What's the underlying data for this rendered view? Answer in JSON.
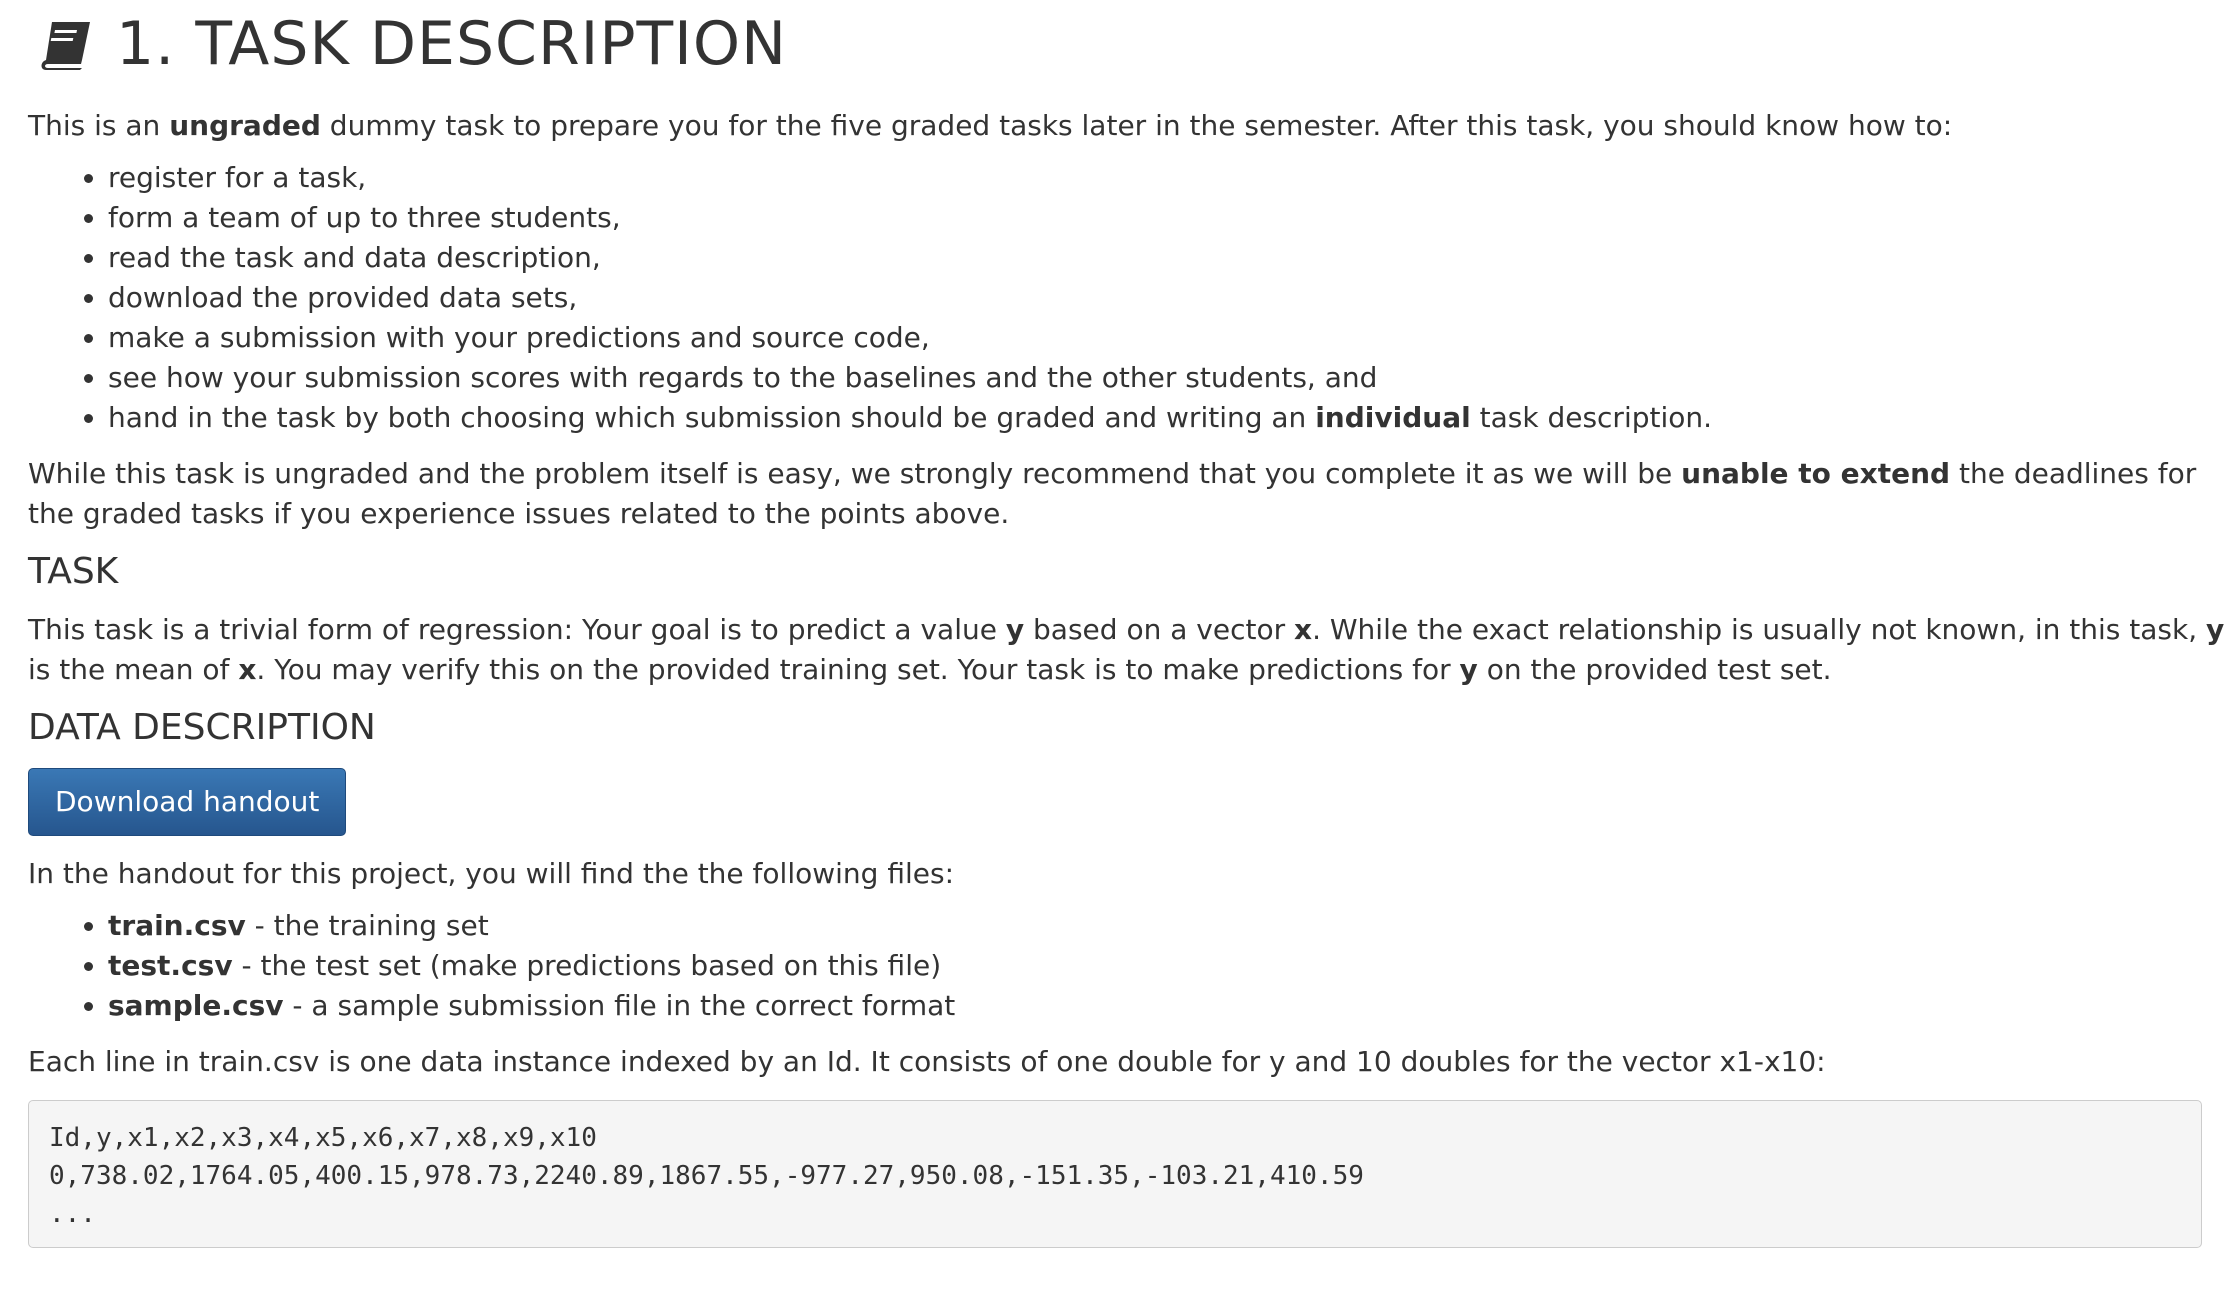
{
  "header": {
    "icon": "book-icon",
    "title": "1. TASK DESCRIPTION"
  },
  "intro": {
    "pre": "This is an ",
    "bold": "ungraded",
    "post": " dummy task to prepare you for the five graded tasks later in the semester. After this task, you should know how to:"
  },
  "learn_items": [
    "register for a task,",
    "form a team of up to three students,",
    "read the task and data description,",
    "download the provided data sets,",
    "make a submission with your predictions and source code,",
    "see how your submission scores with regards to the baselines and the other students, and"
  ],
  "learn_last": {
    "pre": "hand in the task by both choosing which submission should be graded and writing an ",
    "bold": "individual",
    "post": " task description."
  },
  "warning": {
    "pre": "While this task is ungraded and the problem itself is easy, we strongly recommend that you complete it as we will be ",
    "bold": "unable to extend",
    "post": " the deadlines for the graded tasks if you experience issues related to the points above."
  },
  "task_section": {
    "heading": "TASK",
    "t1": "This task is a trivial form of regression: Your goal is to predict a value ",
    "b1": "y",
    "t2": " based on a vector ",
    "b2": "x",
    "t3": ". While the exact relationship is usually not known, in this task, ",
    "b3": "y",
    "t4": " is the mean of ",
    "b4": "x",
    "t5": ". You may verify this on the provided training set. Your task is to make predictions for ",
    "b5": "y",
    "t6": " on the provided test set."
  },
  "data_section": {
    "heading": "DATA DESCRIPTION",
    "download_label": "Download handout",
    "handout_text": "In the handout for this project, you will find the the following files:",
    "files": [
      {
        "name": "train.csv",
        "desc": " - the training set"
      },
      {
        "name": "test.csv",
        "desc": " - the test set (make predictions based on this file)"
      },
      {
        "name": "sample.csv",
        "desc": " - a sample submission file in the correct format"
      }
    ],
    "format_text": "Each line in train.csv is one data instance indexed by an Id. It consists of one double for y and 10 doubles for the vector x1-x10:",
    "code_lines": [
      "Id,y,x1,x2,x3,x4,x5,x6,x7,x8,x9,x10",
      "0,738.02,1764.05,400.15,978.73,2240.89,1867.55,-977.27,950.08,-151.35,-103.21,410.59",
      "..."
    ]
  }
}
